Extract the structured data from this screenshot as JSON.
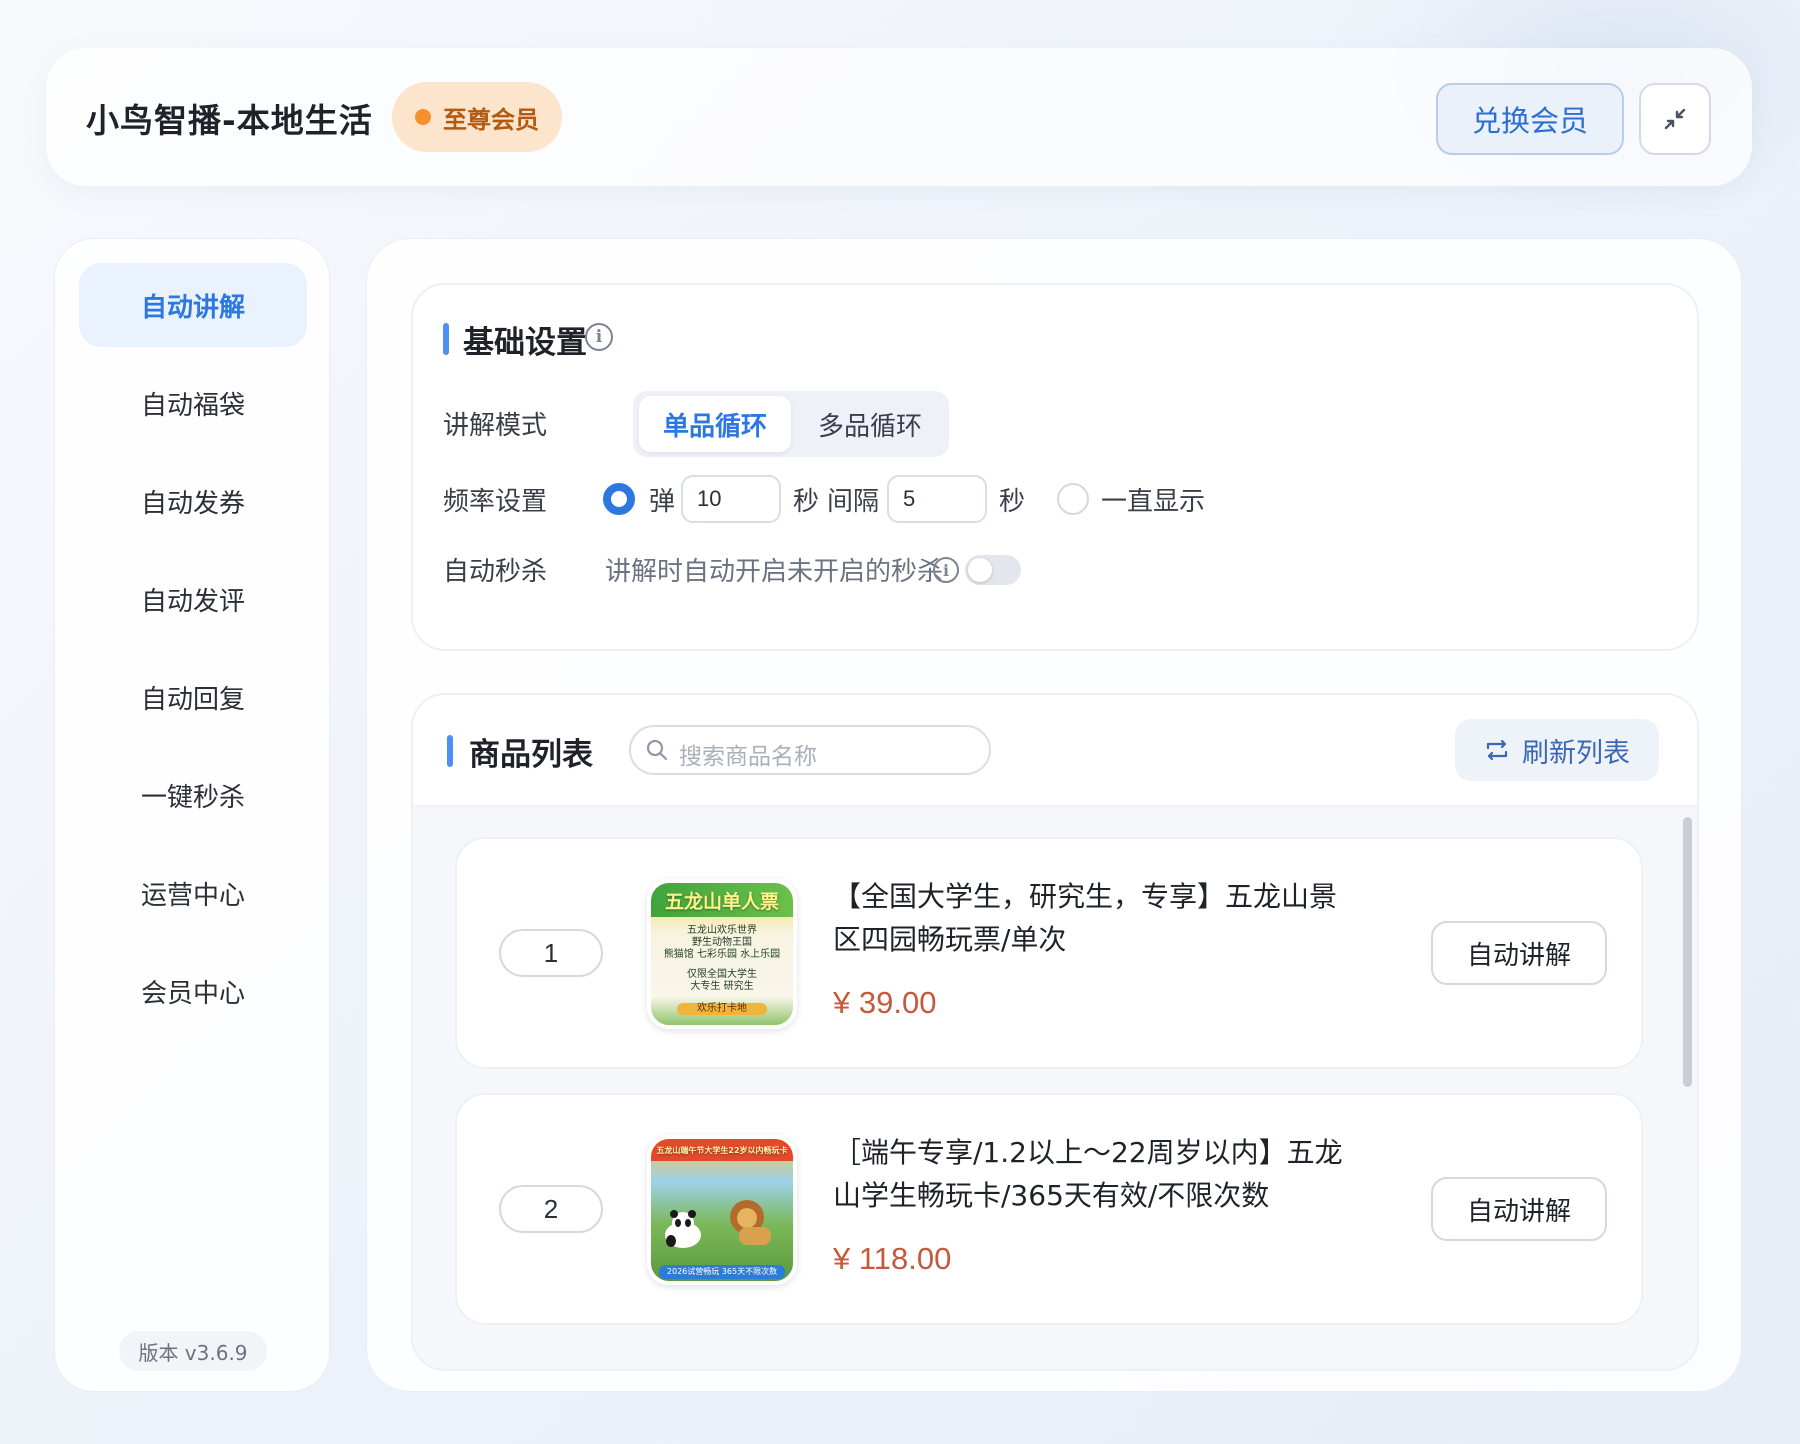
{
  "header": {
    "title": "小鸟智播-本地生活",
    "vip_label": "至尊会员",
    "redeem_label": "兑换会员",
    "colors": {
      "accent": "#2c78e0",
      "vip_bg": "#fde4cc",
      "vip_dot": "#f5902d"
    }
  },
  "sidebar": {
    "items": [
      {
        "label": "自动讲解",
        "active": true
      },
      {
        "label": "自动福袋"
      },
      {
        "label": "自动发券"
      },
      {
        "label": "自动发评"
      },
      {
        "label": "自动回复"
      },
      {
        "label": "一键秒杀"
      },
      {
        "label": "运营中心"
      },
      {
        "label": "会员中心"
      }
    ],
    "version": "版本 v3.6.9"
  },
  "basic": {
    "title": "基础设置",
    "mode_label": "讲解模式",
    "mode_options": [
      "单品循环",
      "多品循环"
    ],
    "mode_selected": "单品循环",
    "freq_label": "频率设置",
    "freq_pop": "弹",
    "freq_pop_value": "10",
    "freq_sec": "秒",
    "freq_interval": "间隔",
    "freq_interval_value": "5",
    "freq_sec2": "秒",
    "freq_always": "一直显示",
    "flash_label": "自动秒杀",
    "flash_desc": "讲解时自动开启未开启的秒杀",
    "flash_enabled": false
  },
  "list": {
    "title": "商品列表",
    "search_placeholder": "搜索商品名称",
    "refresh_label": "刷新列表",
    "products": [
      {
        "index": "1",
        "thumb_title": "五龙山单人票",
        "thumb_lines": [
          "五龙山欢乐世界",
          "野生动物王国",
          "熊猫馆 七彩乐园 水上乐园",
          "仅限全国大学生",
          "大专生 研究生",
          "欢乐打卡地"
        ],
        "name": "【全国大学生，研究生，专享】五龙山景区四园畅玩票/单次",
        "price": "¥ 39.00",
        "action": "自动讲解"
      },
      {
        "index": "2",
        "thumb_title": "五龙山端午节大学生22岁以内畅玩卡",
        "thumb_lines": [
          "2026试营畅玩 365天不限次数"
        ],
        "name": "［端午专享/1.2以上～22周岁以内】五龙山学生畅玩卡/365天有效/不限次数",
        "price": "¥ 118.00",
        "action": "自动讲解"
      }
    ]
  }
}
